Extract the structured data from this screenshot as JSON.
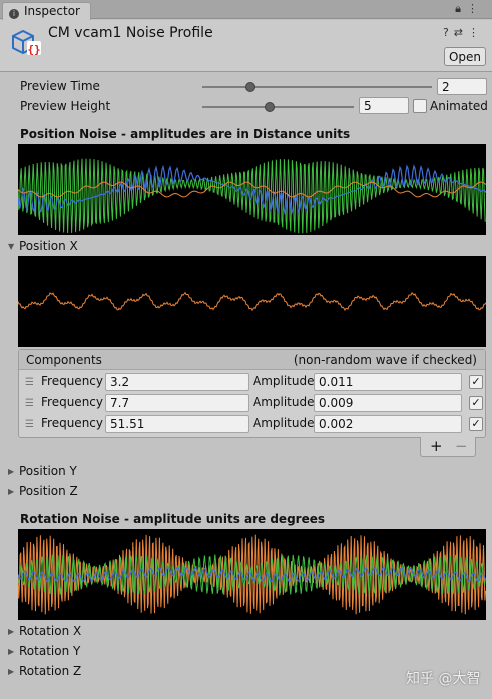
{
  "tab": {
    "label": "Inspector",
    "lock_icon": "lock-icon",
    "menu_icon": "kebab-menu-icon"
  },
  "asset": {
    "title": "CM vcam1 Noise Profile",
    "icon": "noise-profile-asset-icon",
    "open_label": "Open",
    "header_icons": [
      "help-icon",
      "settings-icon",
      "more-icon"
    ]
  },
  "preview": {
    "time_label": "Preview Time",
    "time_value": "2",
    "time_level": 0.21,
    "height_label": "Preview Height",
    "height_value": "5",
    "height_level": 0.45,
    "animated_label": "Animated",
    "animated_checked": false
  },
  "position_noise": {
    "title": "Position Noise - amplitudes are in Distance units"
  },
  "position_x": {
    "label": "Position X",
    "components_header": "Components",
    "checkbox_header": "(non-random wave if checked)",
    "components": [
      {
        "frequency_label": "Frequency",
        "frequency": "3.2",
        "amplitude_label": "Amplitude",
        "amplitude": "0.011",
        "checked": true
      },
      {
        "frequency_label": "Frequency",
        "frequency": "7.7",
        "amplitude_label": "Amplitude",
        "amplitude": "0.009",
        "checked": true
      },
      {
        "frequency_label": "Frequency",
        "frequency": "51.51",
        "amplitude_label": "Amplitude",
        "amplitude": "0.002",
        "checked": true
      }
    ],
    "add_label": "+",
    "remove_label": "−"
  },
  "position_y": {
    "label": "Position Y"
  },
  "position_z": {
    "label": "Position Z"
  },
  "rotation_noise": {
    "title": "Rotation Noise - amplitude units are degrees"
  },
  "rotation_x": {
    "label": "Rotation X"
  },
  "rotation_y": {
    "label": "Rotation Y"
  },
  "rotation_z": {
    "label": "Rotation Z"
  },
  "watermark": "知乎 @大智",
  "colors": {
    "x_wave": "#e8843a",
    "y_wave": "#3fbf3f",
    "z_wave": "#3f6fd8",
    "graph_bg": "#000000"
  }
}
